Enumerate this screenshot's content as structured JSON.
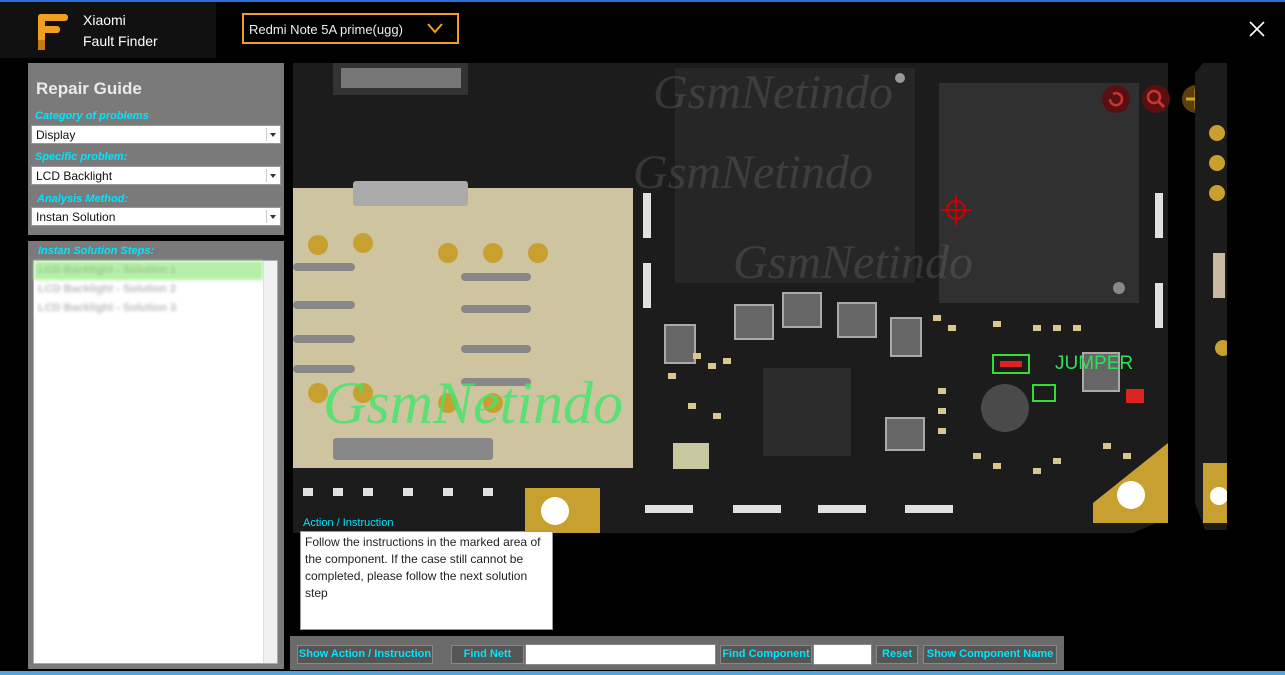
{
  "app": {
    "name_line1": "Xiaomi",
    "name_line2": "Fault Finder"
  },
  "device_selector": {
    "value": "Redmi Note 5A prime(ugg)"
  },
  "repair_guide": {
    "title": "Repair Guide",
    "category_label": "Category of problems",
    "category_value": "Display",
    "specific_label": "Specific problem:",
    "specific_value": "LCD Backlight",
    "method_label": "Analysis Method:",
    "method_value": "Instan Solution"
  },
  "steps": {
    "label": "Instan Solution Steps:",
    "items": [
      "LCD Backlight - Solution 1",
      "LCD Backlight - Solution 2",
      "LCD Backlight - Solution 3"
    ]
  },
  "board": {
    "watermark": "GsmNetindo",
    "jumper_label": "JUMPER"
  },
  "action": {
    "label": "Action / Instruction",
    "text": "Follow the instructions in the marked area of the component. If the case still cannot be completed, please follow the next solution step"
  },
  "toolbar": {
    "show_action": "Show Action / Instruction",
    "find_nett": "Find Nett",
    "find_component": "Find Component",
    "reset": "Reset",
    "show_component_name": "Show Component Name"
  },
  "colors": {
    "accent": "#f0a020",
    "label": "#00e5ff",
    "pcb": "#1c1c1c",
    "highlight": "#b6f0a8"
  }
}
